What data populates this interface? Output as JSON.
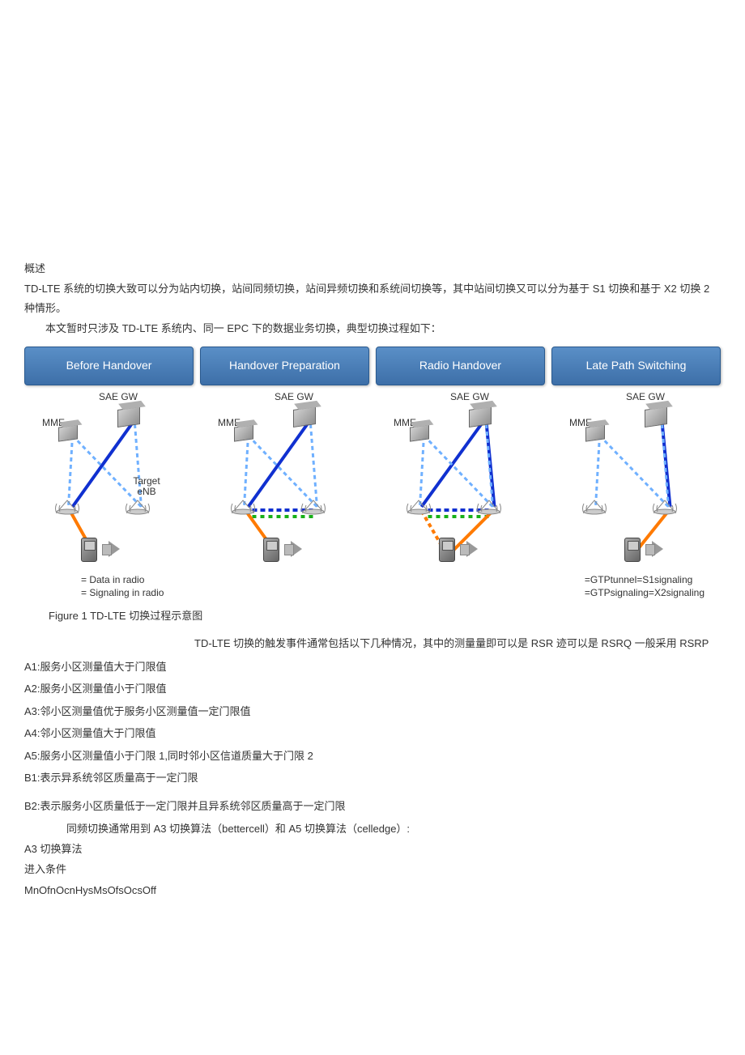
{
  "section_title": "概述",
  "intro_p1": "TD-LTE 系统的切换大致可以分为站内切换，站间同频切换，站间异频切换和系统间切换等，其中站间切换又可以分为基于 S1 切换和基于 X2 切换 2 种情形。",
  "intro_p2": "本文暂时只涉及 TD-LTE 系统内、同一 EPC 下的数据业务切换，典型切换过程如下：",
  "figure": {
    "panels": [
      {
        "title": "Before Handover"
      },
      {
        "title": "Handover Preparation"
      },
      {
        "title": "Radio Handover"
      },
      {
        "title": "Late Path Switching"
      }
    ],
    "labels": {
      "sae_gw": "SAE GW",
      "mme": "MME",
      "target_enb": "Target eNB"
    },
    "legend_left_1": "= Data in radio",
    "legend_left_2": "= Signaling in radio",
    "legend_right_1": "=GTPtunnel=S1signaling",
    "legend_right_2": "=GTPsignaling=X2signaling",
    "caption": "Figure 1 TD-LTE 切换过程示意图"
  },
  "trigger_intro": "TD-LTE 切换的触发事件通常包括以下几种情况，其中的测量量即可以是 RSR 迹可以是 RSRQ 一般采用 RSRP",
  "events": {
    "a1": "A1:服务小区测量值大于门限值",
    "a2": "A2:服务小区测量值小于门限值",
    "a3": "A3:邻小区测量值优于服务小区测量值一定门限值",
    "a4": "A4:邻小区测量值大于门限值",
    "a5": "A5:服务小区测量值小于门限 1,同时邻小区信道质量大于门限 2",
    "b1": "B1:表示异系统邻区质量高于一定门限",
    "b2": "B2:表示服务小区质量低于一定门限并且异系统邻区质量高于一定门限"
  },
  "algo_intro": "同频切换通常用到 A3 切换算法（bettercell）和 A5 切换算法（celledge）:",
  "a3_title": "A3 切换算法",
  "enter_cond": "进入条件",
  "formula": "MnOfnOcnHysMsOfsOcsOff"
}
